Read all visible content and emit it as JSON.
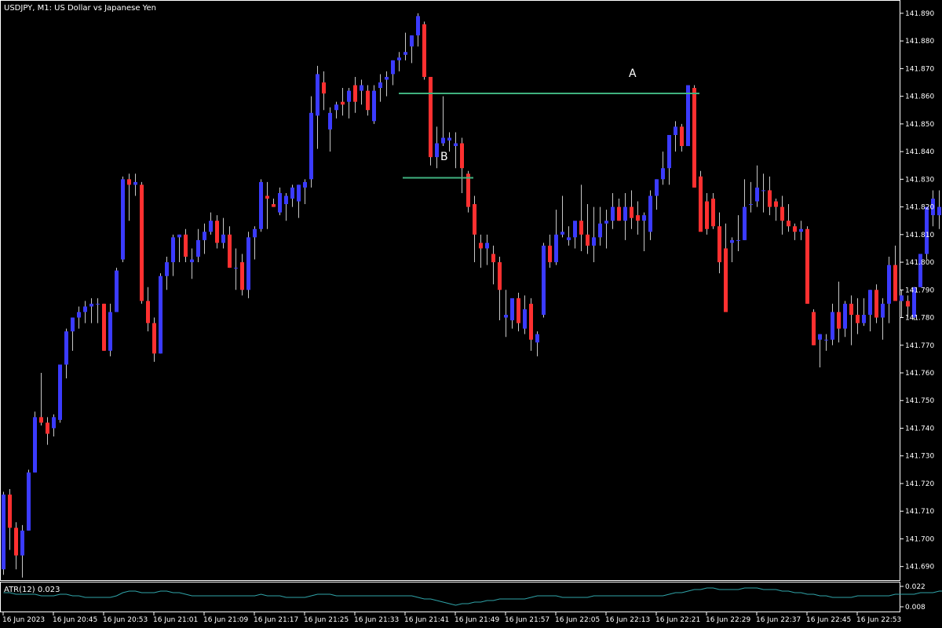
{
  "header": {
    "symbol_line": "USDJPY, M1:  US Dollar vs Japanese Yen"
  },
  "indicator": {
    "label": "ATR(12) 0.023",
    "levels": [
      "0.022",
      "0.008"
    ]
  },
  "annotations": {
    "a": "A",
    "b": "B"
  },
  "colors": {
    "background": "#000000",
    "frame": "#ffffff",
    "bull": "#3b3bff",
    "bear": "#ff3030",
    "wick": "#c8c8c8",
    "level_line": "#3fb27f",
    "atr_line": "#2fa3a8",
    "text": "#ffffff"
  },
  "chart_data": {
    "type": "candlestick",
    "title": "USDJPY, M1:  US Dollar vs Japanese Yen",
    "y_ticks": [
      "141.890",
      "141.880",
      "141.870",
      "141.860",
      "141.850",
      "141.840",
      "141.830",
      "141.820",
      "141.810",
      "141.800",
      "141.790",
      "141.780",
      "141.770",
      "141.760",
      "141.750",
      "141.740",
      "141.730",
      "141.720",
      "141.710",
      "141.700",
      "141.690"
    ],
    "ylim": [
      141.6848,
      141.8948
    ],
    "x_labels": [
      "16 Jun 2023",
      "16 Jun 20:45",
      "16 Jun 20:53",
      "16 Jun 21:01",
      "16 Jun 21:09",
      "16 Jun 21:17",
      "16 Jun 21:25",
      "16 Jun 21:33",
      "16 Jun 21:41",
      "16 Jun 21:49",
      "16 Jun 21:57",
      "16 Jun 22:05",
      "16 Jun 22:13",
      "16 Jun 22:21",
      "16 Jun 22:29",
      "16 Jun 22:37",
      "16 Jun 22:45",
      "16 Jun 22:53"
    ],
    "candles": [
      [
        141.689,
        141.717,
        141.687,
        141.716
      ],
      [
        141.716,
        141.718,
        141.696,
        141.704
      ],
      [
        141.704,
        141.706,
        141.689,
        141.694
      ],
      [
        141.694,
        141.705,
        141.686,
        141.703
      ],
      [
        141.703,
        141.725,
        141.703,
        141.724
      ],
      [
        141.724,
        141.746,
        141.724,
        141.744
      ],
      [
        141.744,
        141.76,
        141.741,
        141.742
      ],
      [
        141.742,
        141.744,
        141.734,
        141.738
      ],
      [
        141.74,
        141.745,
        141.737,
        141.744
      ],
      [
        141.743,
        141.763,
        141.742,
        141.763
      ],
      [
        141.763,
        141.776,
        141.758,
        141.775
      ],
      [
        141.775,
        141.78,
        141.768,
        141.78
      ],
      [
        141.78,
        141.784,
        141.776,
        141.782
      ],
      [
        141.782,
        141.786,
        141.778,
        141.784
      ],
      [
        141.784,
        141.787,
        141.778,
        141.785
      ],
      [
        141.785,
        141.787,
        141.778,
        141.785
      ],
      [
        141.785,
        141.785,
        141.768,
        141.768
      ],
      [
        141.768,
        141.785,
        141.766,
        141.782
      ],
      [
        141.782,
        141.798,
        141.782,
        141.797
      ],
      [
        141.801,
        141.831,
        141.8,
        141.83
      ],
      [
        141.83,
        141.832,
        141.815,
        141.828
      ],
      [
        141.828,
        141.832,
        141.824,
        141.829
      ],
      [
        141.828,
        141.829,
        141.785,
        141.786
      ],
      [
        141.786,
        141.791,
        141.775,
        141.778
      ],
      [
        141.778,
        141.78,
        141.764,
        141.767
      ],
      [
        141.767,
        141.796,
        141.767,
        141.795
      ],
      [
        141.795,
        141.802,
        141.79,
        141.8
      ],
      [
        141.8,
        141.81,
        141.795,
        141.809
      ],
      [
        141.809,
        141.81,
        141.8,
        141.81
      ],
      [
        141.81,
        141.812,
        141.8,
        141.802
      ],
      [
        141.8,
        141.805,
        141.794,
        141.801
      ],
      [
        141.802,
        141.812,
        141.8,
        141.808
      ],
      [
        141.808,
        141.814,
        141.803,
        141.811
      ],
      [
        141.811,
        141.818,
        141.81,
        141.815
      ],
      [
        141.815,
        141.817,
        141.805,
        141.807
      ],
      [
        141.807,
        141.816,
        141.805,
        141.81
      ],
      [
        141.81,
        141.813,
        141.798,
        141.798
      ],
      [
        141.798,
        141.805,
        141.79,
        141.798
      ],
      [
        141.8,
        141.803,
        141.788,
        141.79
      ],
      [
        141.79,
        141.811,
        141.787,
        141.809
      ],
      [
        141.809,
        141.813,
        141.801,
        141.812
      ],
      [
        141.812,
        141.83,
        141.811,
        141.829
      ],
      [
        141.824,
        141.829,
        141.812,
        141.823
      ],
      [
        141.821,
        141.823,
        141.82,
        141.82
      ],
      [
        141.818,
        141.827,
        141.817,
        141.825
      ],
      [
        141.821,
        141.825,
        141.815,
        141.824
      ],
      [
        141.823,
        141.828,
        141.82,
        141.827
      ],
      [
        141.822,
        141.828,
        141.816,
        141.828
      ],
      [
        141.827,
        141.83,
        141.821,
        141.829
      ],
      [
        141.83,
        141.86,
        141.827,
        141.854
      ],
      [
        141.853,
        141.871,
        141.841,
        141.868
      ],
      [
        141.865,
        141.869,
        141.855,
        141.861
      ],
      [
        141.848,
        141.856,
        141.84,
        141.854
      ],
      [
        141.855,
        141.858,
        141.852,
        141.857
      ],
      [
        141.858,
        141.863,
        141.853,
        141.857
      ],
      [
        141.858,
        141.863,
        141.852,
        141.862
      ],
      [
        141.864,
        141.867,
        141.854,
        141.858
      ],
      [
        141.862,
        141.866,
        141.857,
        141.864
      ],
      [
        141.862,
        141.864,
        141.853,
        141.855
      ],
      [
        141.851,
        141.864,
        141.85,
        141.862
      ],
      [
        141.863,
        141.868,
        141.858,
        141.865
      ],
      [
        141.866,
        141.869,
        141.86,
        141.867
      ],
      [
        141.868,
        141.873,
        141.864,
        141.873
      ],
      [
        141.873,
        141.876,
        141.869,
        141.874
      ],
      [
        141.875,
        141.883,
        141.873,
        141.876
      ],
      [
        141.878,
        141.882,
        141.872,
        141.882
      ],
      [
        141.882,
        141.89,
        141.878,
        141.889
      ],
      [
        141.886,
        141.887,
        141.866,
        141.867
      ],
      [
        141.867,
        141.867,
        141.835,
        141.838
      ],
      [
        141.838,
        141.849,
        141.834,
        141.843
      ],
      [
        141.843,
        141.86,
        141.842,
        141.845
      ],
      [
        141.844,
        141.847,
        141.84,
        141.845
      ],
      [
        141.842,
        141.847,
        141.834,
        141.843
      ],
      [
        141.843,
        141.845,
        141.825,
        141.834
      ],
      [
        141.832,
        141.833,
        141.818,
        141.82
      ],
      [
        141.821,
        141.824,
        141.8,
        141.81
      ],
      [
        141.807,
        141.81,
        141.798,
        141.805
      ],
      [
        141.805,
        141.81,
        141.799,
        141.807
      ],
      [
        141.803,
        141.806,
        141.792,
        141.8
      ],
      [
        141.8,
        141.802,
        141.779,
        141.79
      ],
      [
        141.78,
        141.79,
        141.773,
        141.781
      ],
      [
        141.779,
        141.786,
        141.776,
        141.787
      ],
      [
        141.787,
        141.789,
        141.775,
        141.778
      ],
      [
        141.776,
        141.788,
        141.774,
        141.783
      ],
      [
        141.785,
        141.787,
        141.768,
        141.772
      ],
      [
        141.771,
        141.775,
        141.766,
        141.774
      ],
      [
        141.781,
        141.807,
        141.78,
        141.806
      ],
      [
        141.806,
        141.81,
        141.798,
        141.8
      ],
      [
        141.8,
        141.819,
        141.799,
        141.81
      ],
      [
        141.81,
        141.824,
        141.809,
        141.811
      ],
      [
        141.808,
        141.813,
        141.806,
        141.809
      ],
      [
        141.809,
        141.814,
        141.805,
        141.815
      ],
      [
        141.815,
        141.828,
        141.804,
        141.81
      ],
      [
        141.81,
        141.821,
        141.803,
        141.806
      ],
      [
        141.806,
        141.82,
        141.8,
        141.809
      ],
      [
        141.809,
        141.82,
        141.806,
        141.814
      ],
      [
        141.814,
        141.819,
        141.805,
        141.815
      ],
      [
        141.815,
        141.825,
        141.812,
        141.82
      ],
      [
        141.82,
        141.823,
        141.815,
        141.815
      ],
      [
        141.815,
        141.825,
        141.808,
        141.82
      ],
      [
        141.82,
        141.826,
        141.812,
        141.816
      ],
      [
        141.817,
        141.822,
        141.81,
        141.815
      ],
      [
        141.815,
        141.818,
        141.804,
        141.817
      ],
      [
        141.811,
        141.826,
        141.808,
        141.824
      ],
      [
        141.824,
        141.83,
        141.819,
        141.83
      ],
      [
        141.83,
        141.84,
        141.828,
        141.834
      ],
      [
        141.834,
        141.843,
        141.828,
        141.846
      ],
      [
        141.846,
        141.851,
        141.84,
        141.849
      ],
      [
        141.849,
        141.85,
        141.84,
        141.842
      ],
      [
        141.842,
        141.864,
        141.842,
        141.864
      ],
      [
        141.863,
        141.864,
        141.827,
        141.827
      ],
      [
        141.831,
        141.833,
        141.812,
        141.811
      ],
      [
        141.822,
        141.825,
        141.81,
        141.812
      ],
      [
        141.823,
        141.825,
        141.812,
        141.813
      ],
      [
        141.813,
        141.818,
        141.796,
        141.8
      ],
      [
        141.805,
        141.814,
        141.782,
        141.782
      ],
      [
        141.807,
        141.809,
        141.8,
        141.808
      ],
      [
        141.808,
        141.817,
        141.804,
        141.808
      ],
      [
        141.808,
        141.83,
        141.808,
        141.82
      ],
      [
        141.821,
        141.829,
        141.818,
        141.821
      ],
      [
        141.822,
        141.835,
        141.82,
        141.827
      ],
      [
        141.826,
        141.832,
        141.818,
        141.826
      ],
      [
        141.826,
        141.831,
        141.817,
        141.82
      ],
      [
        141.822,
        141.823,
        141.815,
        141.82
      ],
      [
        141.82,
        141.824,
        141.81,
        141.815
      ],
      [
        141.815,
        141.821,
        141.811,
        141.813
      ],
      [
        141.813,
        141.814,
        141.808,
        141.811
      ],
      [
        141.811,
        141.815,
        141.808,
        141.812
      ],
      [
        141.812,
        141.813,
        141.785,
        141.785
      ],
      [
        141.782,
        141.783,
        141.77,
        141.77
      ],
      [
        141.772,
        141.774,
        141.762,
        141.774
      ],
      [
        141.772,
        141.774,
        141.768,
        141.772
      ],
      [
        141.772,
        141.785,
        141.77,
        141.782
      ],
      [
        141.782,
        141.793,
        141.771,
        141.776
      ],
      [
        141.776,
        141.786,
        141.773,
        141.785
      ],
      [
        141.785,
        141.788,
        141.77,
        141.781
      ],
      [
        141.781,
        141.787,
        141.774,
        141.778
      ],
      [
        141.778,
        141.787,
        141.777,
        141.781
      ],
      [
        141.781,
        141.79,
        141.775,
        141.79
      ],
      [
        141.79,
        141.792,
        141.778,
        141.78
      ],
      [
        141.78,
        141.787,
        141.772,
        141.785
      ],
      [
        141.785,
        141.802,
        141.778,
        141.799
      ],
      [
        141.799,
        141.806,
        141.788,
        141.786
      ],
      [
        141.786,
        141.79,
        141.78,
        141.788
      ],
      [
        141.786,
        141.788,
        141.78,
        141.784
      ],
      [
        141.78,
        141.791,
        141.779,
        141.791
      ],
      [
        141.791,
        141.803,
        141.791,
        141.803
      ],
      [
        141.803,
        141.82,
        141.801,
        141.82
      ],
      [
        141.817,
        141.826,
        141.813,
        141.823
      ],
      [
        141.817,
        141.826,
        141.812,
        141.82
      ],
      [
        141.82,
        141.825,
        141.818,
        141.825
      ],
      [
        141.825,
        141.844,
        141.822,
        141.839
      ],
      [
        141.839,
        141.847,
        141.834,
        141.834
      ]
    ],
    "atr": [
      0.018,
      0.018,
      0.017,
      0.017,
      0.017,
      0.017,
      0.016,
      0.016,
      0.016,
      0.017,
      0.017,
      0.016,
      0.016,
      0.015,
      0.015,
      0.015,
      0.015,
      0.015,
      0.016,
      0.018,
      0.019,
      0.019,
      0.018,
      0.018,
      0.018,
      0.019,
      0.019,
      0.018,
      0.018,
      0.017,
      0.016,
      0.016,
      0.016,
      0.016,
      0.016,
      0.016,
      0.016,
      0.016,
      0.016,
      0.016,
      0.016,
      0.017,
      0.016,
      0.016,
      0.016,
      0.015,
      0.015,
      0.015,
      0.015,
      0.016,
      0.017,
      0.017,
      0.017,
      0.016,
      0.016,
      0.016,
      0.016,
      0.016,
      0.016,
      0.016,
      0.016,
      0.016,
      0.016,
      0.016,
      0.016,
      0.016,
      0.015,
      0.014,
      0.014,
      0.013,
      0.012,
      0.011,
      0.01,
      0.011,
      0.011,
      0.012,
      0.012,
      0.013,
      0.013,
      0.014,
      0.014,
      0.014,
      0.014,
      0.014,
      0.015,
      0.016,
      0.016,
      0.016,
      0.016,
      0.015,
      0.015,
      0.015,
      0.015,
      0.015,
      0.016,
      0.016,
      0.016,
      0.016,
      0.016,
      0.016,
      0.016,
      0.016,
      0.016,
      0.016,
      0.016,
      0.016,
      0.017,
      0.018,
      0.018,
      0.019,
      0.02,
      0.02,
      0.021,
      0.021,
      0.02,
      0.02,
      0.02,
      0.02,
      0.021,
      0.021,
      0.021,
      0.02,
      0.02,
      0.02,
      0.019,
      0.019,
      0.018,
      0.018,
      0.017,
      0.017,
      0.016,
      0.016,
      0.015,
      0.015,
      0.015,
      0.015,
      0.016,
      0.016,
      0.016,
      0.016,
      0.016,
      0.016,
      0.017,
      0.017,
      0.017,
      0.017,
      0.018,
      0.018,
      0.018,
      0.019,
      0.019,
      0.02,
      0.02,
      0.02,
      0.021
    ]
  }
}
